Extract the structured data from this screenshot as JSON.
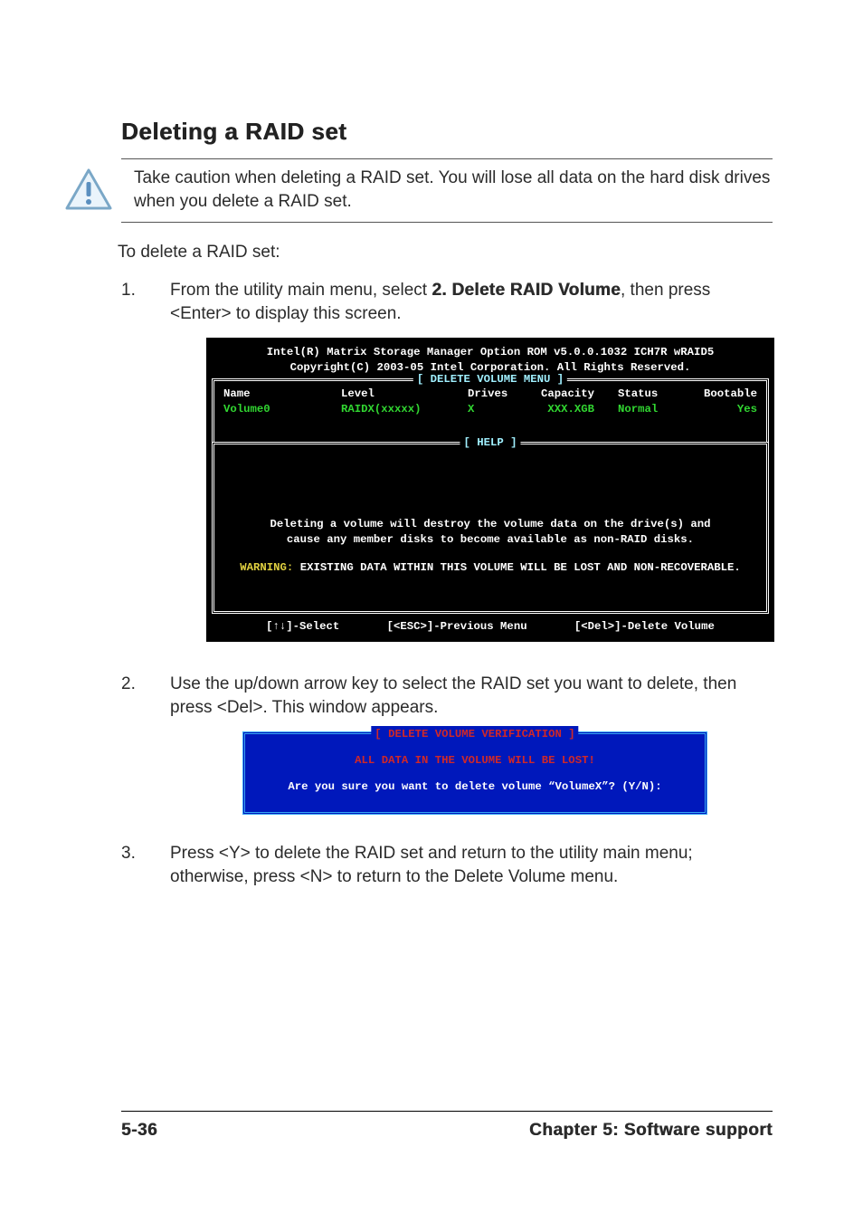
{
  "heading": "Deleting a RAID set",
  "caution": "Take caution when deleting a RAID set. You will lose all data on the hard disk drives when you delete a RAID set.",
  "intro": "To delete a RAID set:",
  "steps": {
    "s1_pre": "From the utility main menu, select ",
    "s1_menu": "2. Delete RAID Volume",
    "s1_post": ", then press <Enter> to display this screen.",
    "s2": "Use the up/down arrow key to select the RAID set you want to delete, then press <Del>. This window appears.",
    "s3": "Press <Y> to delete the RAID set and return to the utility main menu; otherwise, press <N> to return to the Delete Volume menu."
  },
  "bios1": {
    "title1": "Intel(R) Matrix Storage Manager Option ROM v5.0.0.1032 ICH7R wRAID5",
    "title2": "Copyright(C) 2003-05 Intel Corporation. All Rights Reserved.",
    "frame1_label": "[ DELETE VOLUME MENU ]",
    "headers": {
      "name": "Name",
      "level": "Level",
      "drives": "Drives",
      "capacity": "Capacity",
      "status": "Status",
      "bootable": "Bootable"
    },
    "row": {
      "name": "Volume0",
      "level": "RAIDX(xxxxx)",
      "drives": "X",
      "capacity": "XXX.XGB",
      "status": "Normal",
      "bootable": "Yes"
    },
    "frame2_label": "[ HELP ]",
    "help_line1": "Deleting a volume will destroy the volume data on the drive(s) and",
    "help_line2": "cause any member disks to become available as non-RAID disks.",
    "warn_label": "WARNING:",
    "warn_text": " EXISTING DATA WITHIN THIS VOLUME WILL BE LOST AND NON-RECOVERABLE.",
    "footer_select": "[↑↓]-Select",
    "footer_prev": "[<ESC>]-Previous Menu",
    "footer_del": "[<Del>]-Delete Volume"
  },
  "bios2": {
    "title": "[ DELETE VOLUME VERIFICATION ]",
    "warn": "ALL DATA IN THE VOLUME WILL BE LOST!",
    "question": "Are you sure you want to delete volume “VolumeX”? (Y/N):"
  },
  "footer": {
    "left": "5-36",
    "right": "Chapter 5: Software support"
  }
}
